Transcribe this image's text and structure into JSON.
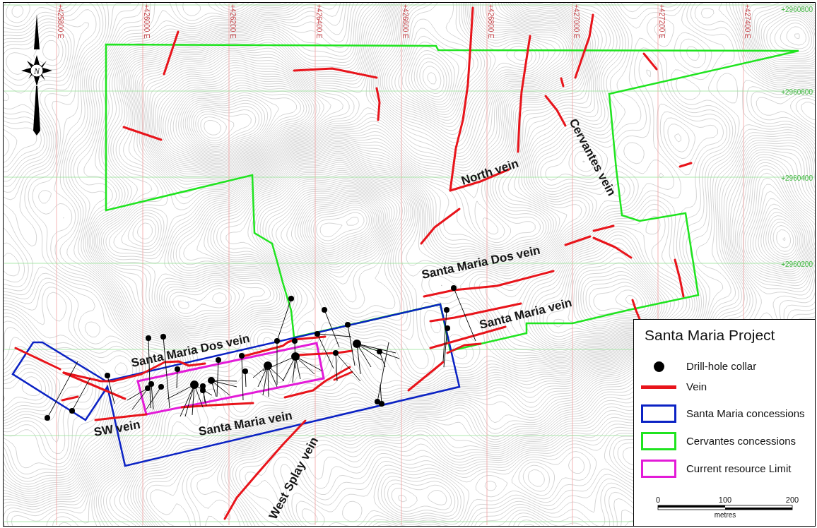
{
  "map": {
    "eastings": [
      "+425800 E",
      "+426000 E",
      "+426200 E",
      "+426400 E",
      "+426600 E",
      "+426800 E",
      "+427000 E",
      "+427200 E",
      "+427400 E"
    ],
    "northings": [
      "+2960800",
      "+2960600",
      "+2960400",
      "+2960200"
    ],
    "north_arrow": {
      "letter": "N"
    },
    "vein_labels": [
      "North vein",
      "Cervantes vein",
      "Santa Maria Dos vein",
      "Santa Maria vein",
      "Santa Maria Dos vein",
      "Santa Maria vein",
      "SW vein",
      "West Splay vein"
    ]
  },
  "legend": {
    "title": "Santa Maria Project",
    "items": [
      {
        "kind": "dot",
        "label": "Drill-hole collar",
        "color": "#000000"
      },
      {
        "kind": "line",
        "label": "Vein",
        "color": "#e8141b"
      },
      {
        "kind": "outline",
        "label": "Santa Maria concessions",
        "color": "#0b22c4"
      },
      {
        "kind": "outline",
        "label": "Cervantes concessions",
        "color": "#1fe41f"
      },
      {
        "kind": "outline",
        "label": "Current resource Limit",
        "color": "#e31bd8"
      }
    ],
    "scale_bar": {
      "ticks": [
        "0",
        "100",
        "200"
      ],
      "unit": "metres"
    }
  }
}
